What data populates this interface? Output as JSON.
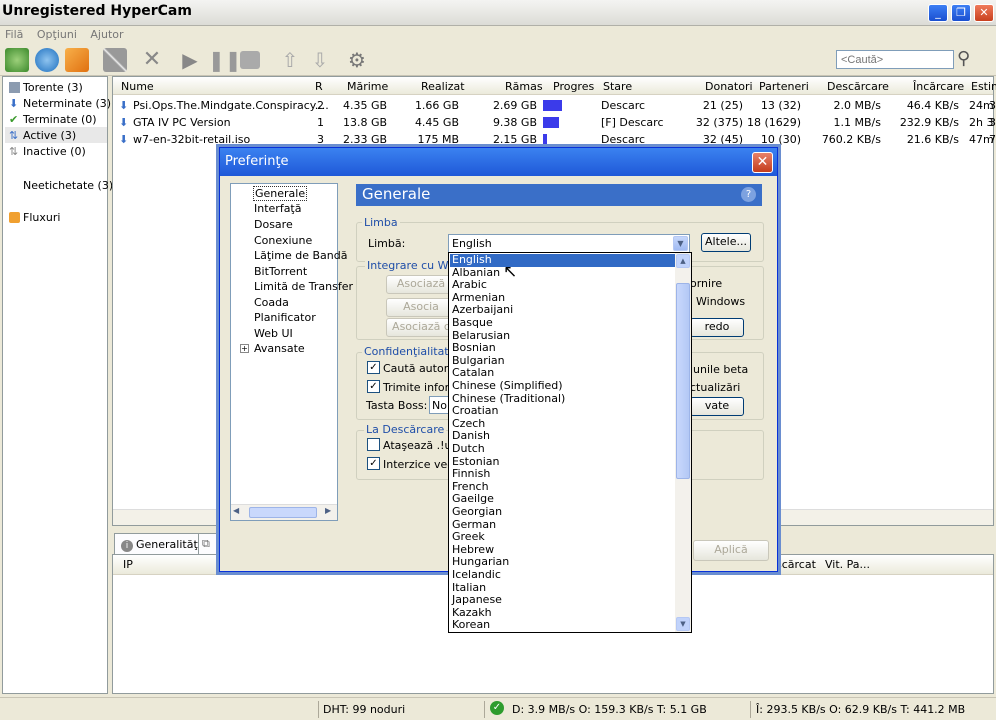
{
  "window": {
    "title": "Unregistered HyperCam"
  },
  "menu": [
    "Filă",
    "Opţiuni",
    "Ajutor"
  ],
  "search": {
    "placeholder": "<Caută>"
  },
  "sidebar": {
    "items": [
      {
        "label": "Torente (3)",
        "icon": "torrents-icon"
      },
      {
        "label": "Neterminate (3)",
        "icon": "download-arrow-icon"
      },
      {
        "label": "Terminate (0)",
        "icon": "check-icon"
      },
      {
        "label": "Active (3)",
        "icon": "active-arrows-icon",
        "selected": true
      },
      {
        "label": "Inactive (0)",
        "icon": "inactive-arrows-icon"
      }
    ],
    "unlabeled": "Neetichetate (3)",
    "feeds": "Fluxuri"
  },
  "torrents": {
    "columns": [
      "Nume",
      "R",
      "Mărime",
      "Realizat",
      "Rămas",
      "Progres",
      "Stare",
      "Donatori",
      "Parteneri",
      "Descărcare",
      "Încărcare",
      "Estim"
    ],
    "rows": [
      {
        "name": "Psi.Ops.The.Mindgate.Conspiracy....",
        "r": "2",
        "size": "4.35 GB",
        "done": "1.66 GB",
        "left": "2.69 GB",
        "progress": "38.2%",
        "progress_value": 0.382,
        "state": "Descarc",
        "seeds": "21 (25)",
        "peers": "13 (32)",
        "down": "2.0 MB/s",
        "up": "46.4 KB/s",
        "eta": "24m"
      },
      {
        "name": "GTA IV PC Version",
        "r": "1",
        "size": "13.8 GB",
        "done": "4.45 GB",
        "left": "9.38 GB",
        "progress": "32.2%",
        "progress_value": 0.322,
        "state": "[F] Descarc",
        "seeds": "32 (375)",
        "peers": "18 (1629)",
        "down": "1.1 MB/s",
        "up": "232.9 KB/s",
        "eta": "2h 3"
      },
      {
        "name": "w7-en-32bit-retail.iso",
        "r": "3",
        "size": "2.33 GB",
        "done": "175 MB",
        "left": "2.15 GB",
        "progress": "7.3%",
        "progress_value": 0.073,
        "state": "Descarc",
        "seeds": "32 (45)",
        "peers": "10 (30)",
        "down": "760.2 KB/s",
        "up": "21.6 KB/s",
        "eta": "47m"
      }
    ]
  },
  "bottom": {
    "tab_general": "Generalităţi",
    "col_ip": "IP",
    "col_downloaded": "scărcat",
    "col_speed": "Vit. Pa..."
  },
  "status": {
    "dht": "DHT: 99 noduri",
    "down": "D: 3.9 MB/s O: 159.3 KB/s T: 5.1 GB",
    "up": "Î: 293.5 KB/s O: 62.9 KB/s T: 441.2 MB"
  },
  "dialog": {
    "title": "Preferinţe",
    "tree": [
      "Generale",
      "Interfaţă",
      "Dosare",
      "Conexiune",
      "Lăţime de Bandă",
      "BitTorrent",
      "Limită de Transfer",
      "Coada",
      "Planificator",
      "Web UI",
      "Avansate"
    ],
    "panel_title": "Generale",
    "group_language": "Limba",
    "language_label": "Limbă:",
    "language_value": "English",
    "other_button": "Altele...",
    "group_integration": "Integrare cu Wind",
    "assoc1": "Asociază",
    "assoc2": "Asocia",
    "assoc3": "Asociază c",
    "startup_text": "ornire",
    "windows_text": "Windows",
    "redo_button": "redo",
    "group_privacy": "Confidenţialitate",
    "check_updates": "Caută automat",
    "send_info": "Trimite informa",
    "beta_text": "iunile beta",
    "updates_text": "ctualizări",
    "boss_label": "Tasta Boss:",
    "boss_value": "Non",
    "vate_button": "vate",
    "group_download": "La Descărcare",
    "attach": "Ataşează .!ut",
    "prevent": "Interzice veghe",
    "apply_button": "Aplică"
  },
  "languages": [
    "English",
    "Albanian",
    "Arabic",
    "Armenian",
    "Azerbaijani",
    "Basque",
    "Belarusian",
    "Bosnian",
    "Bulgarian",
    "Catalan",
    "Chinese (Simplified)",
    "Chinese (Traditional)",
    "Croatian",
    "Czech",
    "Danish",
    "Dutch",
    "Estonian",
    "Finnish",
    "French",
    "Gaeilge",
    "Georgian",
    "German",
    "Greek",
    "Hebrew",
    "Hungarian",
    "Icelandic",
    "Italian",
    "Japanese",
    "Kazakh",
    "Korean"
  ],
  "colors": {
    "accent": "#316ac5",
    "progress": "#3b3bea",
    "titlebar": "#1f58d8"
  }
}
